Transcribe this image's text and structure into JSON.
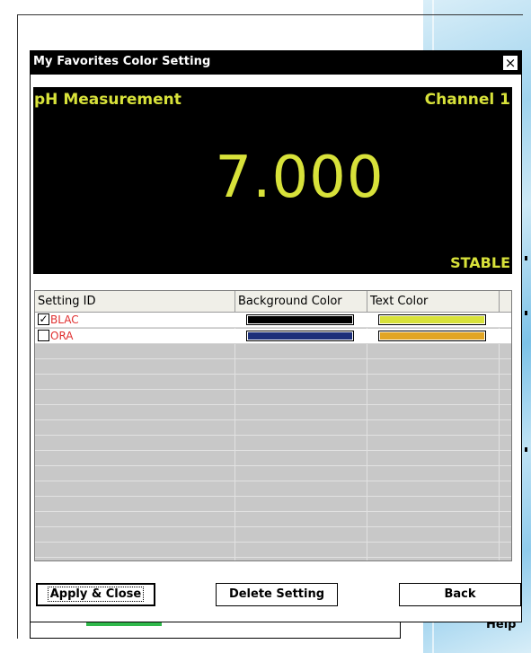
{
  "background": {
    "help_label": "Help"
  },
  "dialog": {
    "title": "My Favorites Color Setting",
    "close_glyph": "×"
  },
  "preview": {
    "title": "pH Measurement",
    "channel": "Channel 1",
    "value": "7.000",
    "status": "STABLE",
    "colors": {
      "background": "#000000",
      "text": "#d8e23a"
    }
  },
  "grid": {
    "headers": [
      "Setting ID",
      "Background Color",
      "Text Color"
    ],
    "rows": [
      {
        "checked": "✓",
        "id": "BLAC",
        "background_color": "#000000",
        "text_color": "#d8e23a"
      },
      {
        "checked": "",
        "id": "ORA",
        "background_color": "#1c2f7a",
        "text_color": "#e2a524"
      }
    ]
  },
  "buttons": {
    "apply_close": "Apply & Close",
    "delete_setting": "Delete Setting",
    "back": "Back"
  }
}
